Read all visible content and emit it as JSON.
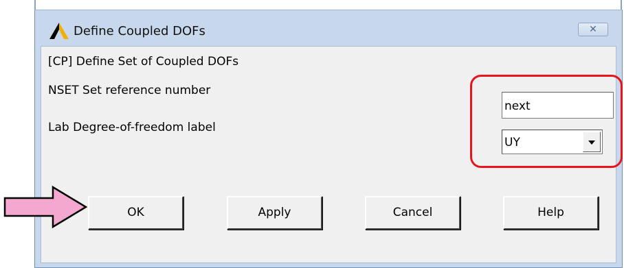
{
  "window": {
    "title": "Define Coupled DOFs",
    "close_glyph": "✕"
  },
  "form": {
    "heading": "[CP]  Define Set of Coupled DOFs",
    "nset_label": "NSET  Set reference number",
    "nset_value": "next",
    "lab_label": "Lab   Degree-of-freedom label",
    "lab_value": "UY"
  },
  "buttons": {
    "ok": "OK",
    "apply": "Apply",
    "cancel": "Cancel",
    "help": "Help"
  },
  "annotations": {
    "highlight_color": "#e8141c",
    "arrow_color": "#f4a7cf"
  }
}
